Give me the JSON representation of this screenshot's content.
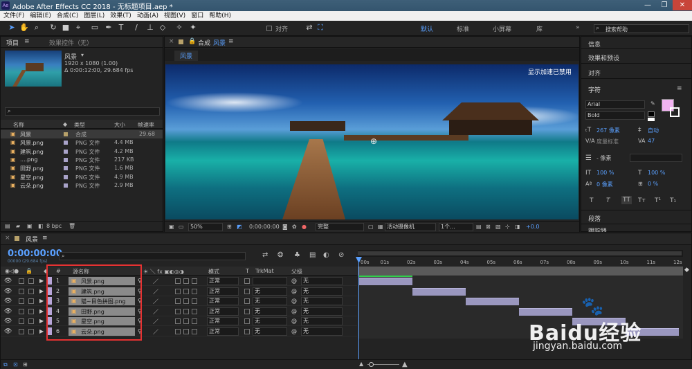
{
  "window": {
    "title": "Adobe After Effects CC 2018 - 无标题项目.aep *"
  },
  "menu": [
    "文件(F)",
    "编辑(E)",
    "合成(C)",
    "图层(L)",
    "效果(T)",
    "动画(A)",
    "视图(V)",
    "窗口",
    "帮助(H)"
  ],
  "toolbar": {
    "snap_label": "对齐",
    "workspaces": [
      "默认",
      "标准",
      "小屏幕",
      "库"
    ],
    "search_placeholder": "搜索帮助"
  },
  "project": {
    "tab": "项目",
    "tab2": "效果控件（无）",
    "comp_name": "风景",
    "comp_size": "1920 x 1080 (1.00)",
    "comp_duration": "Δ 0:00:12:00, 29.684 fps",
    "search_placeholder": "",
    "headers": {
      "name": "名称",
      "type": "类型",
      "size": "大小",
      "fps": "帧速率"
    },
    "items": [
      {
        "name": "风景",
        "type": "合成",
        "size": "",
        "fps": "29.68",
        "color": "#b7a16a"
      },
      {
        "name": "风景.png",
        "type": "PNG 文件",
        "size": "4.4 MB",
        "fps": "",
        "color": "#a9a3c9"
      },
      {
        "name": "建筑.png",
        "type": "PNG 文件",
        "size": "4.2 MB",
        "fps": "",
        "color": "#a9a3c9"
      },
      {
        "name": "....png",
        "type": "PNG 文件",
        "size": "217 KB",
        "fps": "",
        "color": "#a9a3c9"
      },
      {
        "name": "田野.png",
        "type": "PNG 文件",
        "size": "1.6 MB",
        "fps": "",
        "color": "#a9a3c9"
      },
      {
        "name": "星空.png",
        "type": "PNG 文件",
        "size": "4.9 MB",
        "fps": "",
        "color": "#a9a3c9"
      },
      {
        "name": "云朵.png",
        "type": "PNG 文件",
        "size": "2.9 MB",
        "fps": "",
        "color": "#a9a3c9"
      }
    ],
    "bpc": "8 bpc"
  },
  "composition": {
    "tab_prefix": "合成",
    "tab_name": "风景",
    "subtab": "风景",
    "overlay_text": "显示加速已禁用",
    "zoom": "50%",
    "timecode": "0:00:00:00",
    "resolution": "完整",
    "camera": "活动摄像机",
    "views": "1个...",
    "exposure": "+0.0"
  },
  "right_panel": {
    "items": [
      "信息",
      "效果和预设",
      "对齐"
    ],
    "character_title": "字符",
    "font": "Arial",
    "style": "Bold",
    "size": "267 像素",
    "leading": "自动",
    "kerning": "度量标准",
    "tracking": "47",
    "stroke": "- 像素",
    "vscale": "100 %",
    "hscale": "100 %",
    "baseline": "0 像素",
    "tsume": "0 %",
    "text_buttons": [
      "T",
      "T",
      "TT",
      "Tт",
      "T¹",
      "T₁"
    ],
    "paragraph_title": "段落",
    "tracker_title": "跟踪器",
    "fill_color": "#f2b3f2"
  },
  "timeline": {
    "tab": "风景",
    "timecode": "0:00:00:00",
    "timecode_sub": "00000 (29.684 fps)",
    "headers": {
      "num": "#",
      "source": "源名称",
      "mode": "模式",
      "t": "T",
      "trkmat": "TrkMat",
      "parent": "父级"
    },
    "ruler": [
      "00s",
      "01s",
      "02s",
      "03s",
      "04s",
      "05s",
      "06s",
      "07s",
      "08s",
      "09s",
      "10s",
      "11s",
      "12s"
    ],
    "layers": [
      {
        "num": "1",
        "name": "风景.png",
        "mode": "正常",
        "trkmat": "",
        "parent": "无",
        "start": 0,
        "end": 2
      },
      {
        "num": "2",
        "name": "建筑.png",
        "mode": "正常",
        "trkmat": "无",
        "parent": "无",
        "start": 2,
        "end": 4
      },
      {
        "num": "3",
        "name": "猫~目色拼图.png",
        "mode": "正常",
        "trkmat": "无",
        "parent": "无",
        "start": 4,
        "end": 6
      },
      {
        "num": "4",
        "name": "田野.png",
        "mode": "正常",
        "trkmat": "无",
        "parent": "无",
        "start": 6,
        "end": 8
      },
      {
        "num": "5",
        "name": "星空.png",
        "mode": "正常",
        "trkmat": "无",
        "parent": "无",
        "start": 8,
        "end": 10
      },
      {
        "num": "6",
        "name": "云朵.png",
        "mode": "正常",
        "trkmat": "无",
        "parent": "无",
        "start": 10,
        "end": 12
      }
    ],
    "duration_seconds": 12,
    "layer_label_color": "#b8a5d8"
  },
  "watermark": {
    "brand": "Baidu经验",
    "url": "jingyan.baidu.com"
  }
}
